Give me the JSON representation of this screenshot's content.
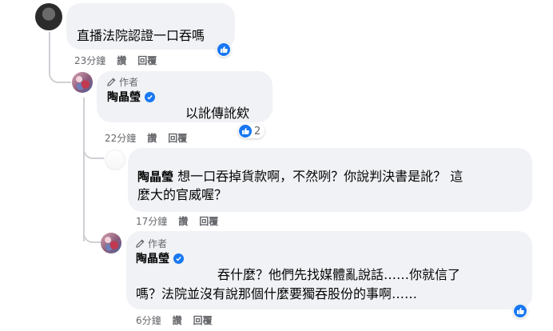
{
  "comments": [
    {
      "text": "直播法院認證一口吞嗎",
      "time": "23分鐘",
      "like_label": "讚",
      "reply_label": "回覆",
      "reaction_icon": "like-icon"
    },
    {
      "author_tag": "作者",
      "name": "陶晶瑩",
      "text": "以訛傳訛欸",
      "time": "22分鐘",
      "like_label": "讚",
      "reply_label": "回覆",
      "reaction_icon": "like-icon",
      "reaction_count": "2"
    },
    {
      "mention": "陶晶瑩",
      "text_line1": "想一口吞掉貨款啊，不然咧？你說判決書是訛？ 這",
      "text_line2": "麼大的官威喔？",
      "time": "17分鐘",
      "like_label": "讚",
      "reply_label": "回覆"
    },
    {
      "author_tag": "作者",
      "name": "陶晶瑩",
      "text_line1": "吞什麼？他們先找媒體亂說話……你就信了",
      "text_line2": "嗎？法院並沒有說那個什麼要獨吞股份的事啊……",
      "time": "6分鐘",
      "like_label": "讚",
      "reply_label": "回覆",
      "reaction_icon": "like-icon"
    }
  ],
  "colors": {
    "bubble": "#f0f2f5",
    "accent": "#1877f2",
    "meta_text": "#65676b",
    "thread_line": "#ced0d4"
  }
}
